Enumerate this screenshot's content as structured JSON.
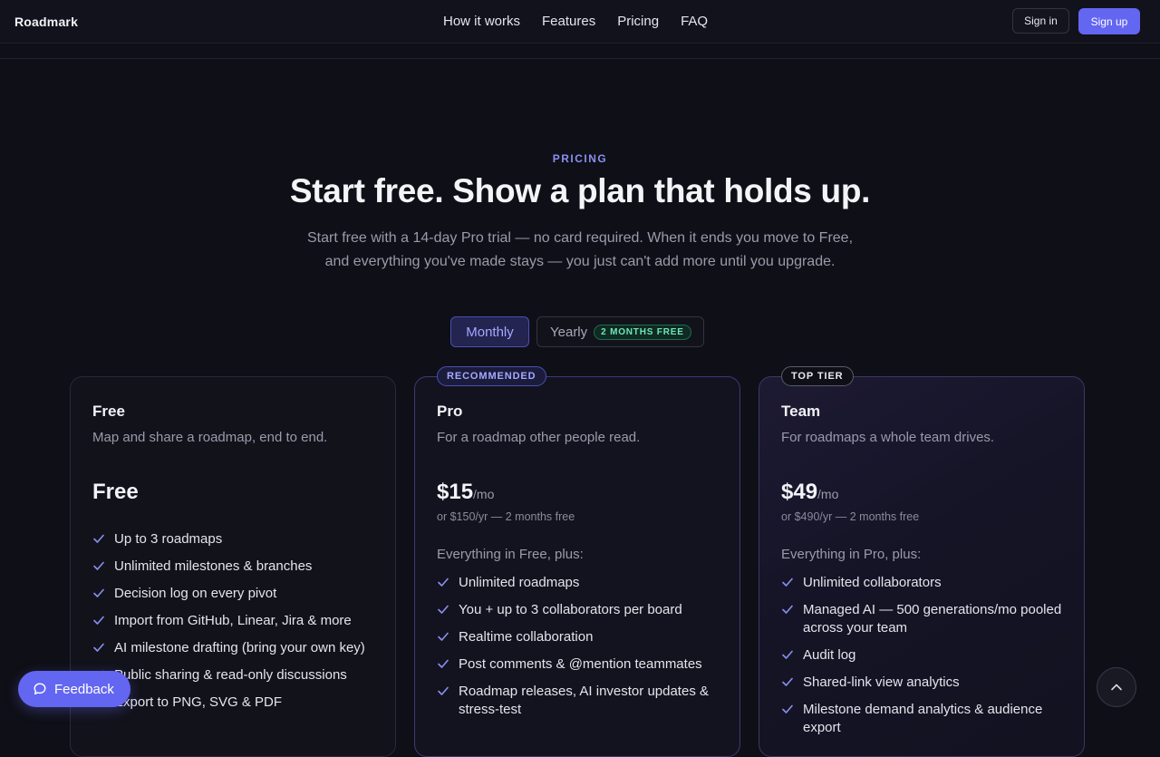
{
  "header": {
    "brand": "Roadmark",
    "nav": [
      "How it works",
      "Features",
      "Pricing",
      "FAQ"
    ],
    "sign_in": "Sign in",
    "sign_up": "Sign up"
  },
  "hero": {
    "eyebrow": "PRICING",
    "title": "Start free. Show a plan that holds up.",
    "subtitle_line1": "Start free with a 14-day Pro trial — no card required. When it ends you move to Free,",
    "subtitle_line2": "and everything you've made stays — you just can't add more until you upgrade."
  },
  "billing_toggle": {
    "monthly": "Monthly",
    "yearly": "Yearly",
    "yearly_badge": "2 MONTHS FREE",
    "selected": "Monthly"
  },
  "plans": [
    {
      "name": "Free",
      "description": "Map and share a roadmap, end to end.",
      "price": "Free",
      "features": [
        "Up to 3 roadmaps",
        "Unlimited milestones & branches",
        "Decision log on every pivot",
        "Import from GitHub, Linear, Jira & more",
        "AI milestone drafting (bring your own key)",
        "Public sharing & read-only discussions",
        "Export to PNG, SVG & PDF"
      ]
    },
    {
      "name": "Pro",
      "tag": "RECOMMENDED",
      "description": "For a roadmap other people read.",
      "price": "$15",
      "period": "/mo",
      "yearly_note": "or $150/yr — 2 months free",
      "everything_in": "Everything in Free, plus:",
      "features": [
        "Unlimited roadmaps",
        "You + up to 3 collaborators per board",
        "Realtime collaboration",
        "Post comments & @mention teammates",
        "Roadmap releases, AI investor updates & stress-test"
      ]
    },
    {
      "name": "Team",
      "tag": "TOP TIER",
      "description": "For roadmaps a whole team drives.",
      "price": "$49",
      "period": "/mo",
      "yearly_note": "or $490/yr — 2 months free",
      "everything_in": "Everything in Pro, plus:",
      "features": [
        "Unlimited collaborators",
        "Managed AI — 500 generations/mo pooled across your team",
        "Audit log",
        "Shared-link view analytics",
        "Milestone demand analytics & audience export"
      ]
    }
  ],
  "feedback_button": "Feedback",
  "icons": {
    "check": "check-icon",
    "feedback": "chat-bubble-icon",
    "scroll": "chevron-up-icon"
  },
  "colors": {
    "accent": "#6366f1",
    "background": "#0f0f17",
    "badge_green": "#6ee7b7"
  }
}
